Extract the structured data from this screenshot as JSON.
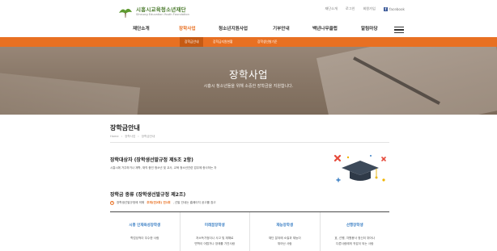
{
  "header": {
    "logo_ko": "시흥시교육청소년재단",
    "logo_en": "Siheung Education Youth Foundation",
    "util": [
      "재단소개",
      "로그인",
      "회원가입"
    ],
    "facebook_label": "facebook"
  },
  "gnb": {
    "items": [
      "재단소개",
      "장학사업",
      "청소년지원사업",
      "기부안내",
      "백년나무클럽",
      "알림마당"
    ],
    "active_index": 1
  },
  "subnav": {
    "items": [
      "장학금안내",
      "장학금지원현황",
      "장학생선발기준"
    ],
    "active_index": 0
  },
  "hero": {
    "title": "장학사업",
    "subtitle": "시흥시 청소년들을 위해 소중한 장학금을 지원합니다."
  },
  "page": {
    "title": "장학금안내",
    "breadcrumb": [
      "Home",
      "장학사업",
      "장학금안내"
    ]
  },
  "section1": {
    "title": "장학대상자 (장학생선발규정 제5조 2항)",
    "text": "시흥시에 거주하거나 재학, 재직 중인 청소년 및 교사, 교육 청소년관련 업무에 종사하는 자"
  },
  "section2": {
    "title": "장학금 종류 (장학생선발규정 제2조)",
    "note_prefix": "장학생선발규정에 의해",
    "note_highlight": "추계(연2회) 연1회",
    "note_suffix": ", 선발 안내는 홈페이지 공고를 참고"
  },
  "scholarships": [
    {
      "name": "시흥 인재육성장학생",
      "lines": [
        "학업성적이 우수한 사람"
      ]
    },
    {
      "name": "미래꿈장학생",
      "lines": [
        "저소득가정이나 사고 및 재해로",
        "면학이 어렵거나 장애를 가진사람"
      ]
    },
    {
      "name": "재능장학생",
      "lines": [
        "재단 분야에 소질과 재능이",
        "뛰어난 사람"
      ]
    },
    {
      "name": "선행장학생",
      "lines": [
        "효, 선행, 자원봉사 정신이 뛰어나",
        "다른사람에게 귀감이 되는 사람"
      ]
    }
  ],
  "colors": {
    "brand_orange": "#e87022",
    "link_blue": "#3b7fc4",
    "logo_green": "#4a7a2c"
  }
}
